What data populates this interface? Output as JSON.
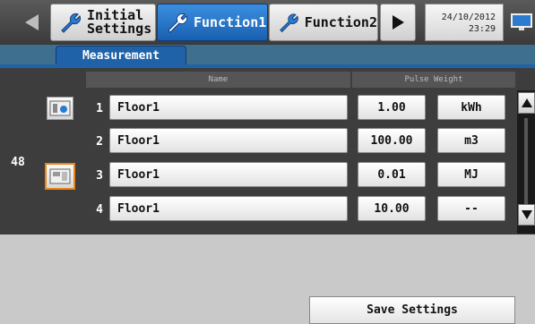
{
  "header": {
    "tabs": [
      {
        "label_line1": "Initial",
        "label_line2": "Settings",
        "active": false
      },
      {
        "label": "Function1",
        "active": true
      },
      {
        "label": "Function2",
        "active": false
      }
    ],
    "date": "24/10/2012",
    "time": "23:29",
    "icons": {
      "prev": "left-arrow-icon",
      "next": "right-arrow-icon",
      "tool": "wrench-icon",
      "display": "monitor-icon"
    }
  },
  "subtab": {
    "label": "Measurement"
  },
  "table": {
    "columns": {
      "name": "Name",
      "pulse_weight": "Pulse Weight"
    },
    "group_number": "48",
    "rows": [
      {
        "num": "1",
        "name": "Floor1",
        "weight": "1.00",
        "unit": "kWh"
      },
      {
        "num": "2",
        "name": "Floor1",
        "weight": "100.00",
        "unit": "m3"
      },
      {
        "num": "3",
        "name": "Floor1",
        "weight": "0.01",
        "unit": "MJ"
      },
      {
        "num": "4",
        "name": "Floor1",
        "weight": "10.00",
        "unit": "--"
      }
    ]
  },
  "footer": {
    "save_label": "Save Settings"
  },
  "colors": {
    "accent": "#2062a8",
    "selection": "#e8861a"
  }
}
